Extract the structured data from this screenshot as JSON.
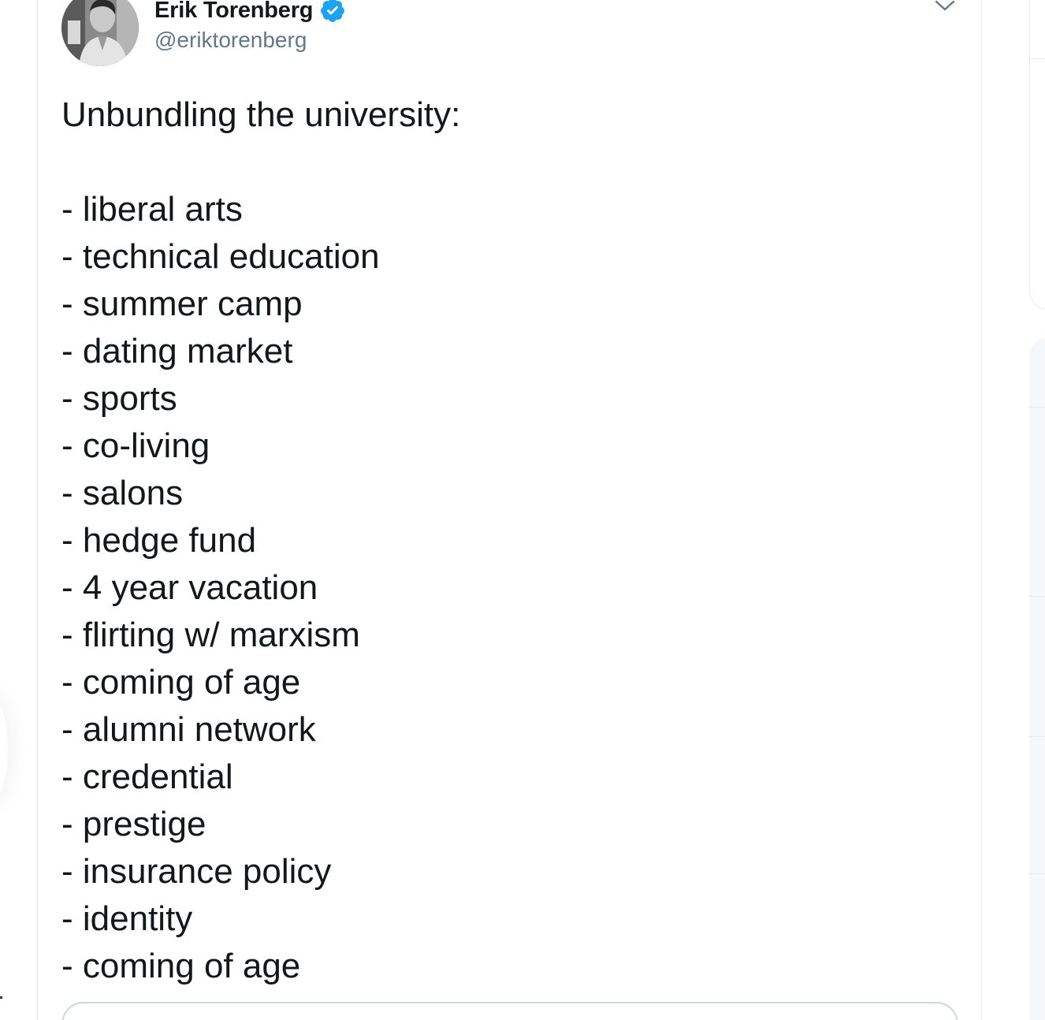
{
  "author": {
    "display_name": "Erik Torenberg",
    "handle": "@eriktorenberg",
    "verified": true,
    "avatar_icon": "profile-photo",
    "verified_icon": "verified-badge-icon"
  },
  "colors": {
    "text": "#14171a",
    "secondary_text": "#657786",
    "verified_blue": "#1da1f2",
    "border": "#e6ecf0"
  },
  "tweet": {
    "heading": "Unbundling the university:",
    "items": [
      "- liberal arts",
      "- technical education",
      "- summer camp",
      "- dating market",
      "- sports",
      "- co-living",
      "- salons",
      "- hedge fund",
      "- 4 year vacation",
      "- flirting w/ marxism",
      "- coming of age",
      "- alumni network",
      "- credential",
      "- prestige",
      "- insurance policy",
      "- identity",
      "- coming of age"
    ]
  },
  "menu": {
    "caret_icon": "chevron-down-icon"
  }
}
